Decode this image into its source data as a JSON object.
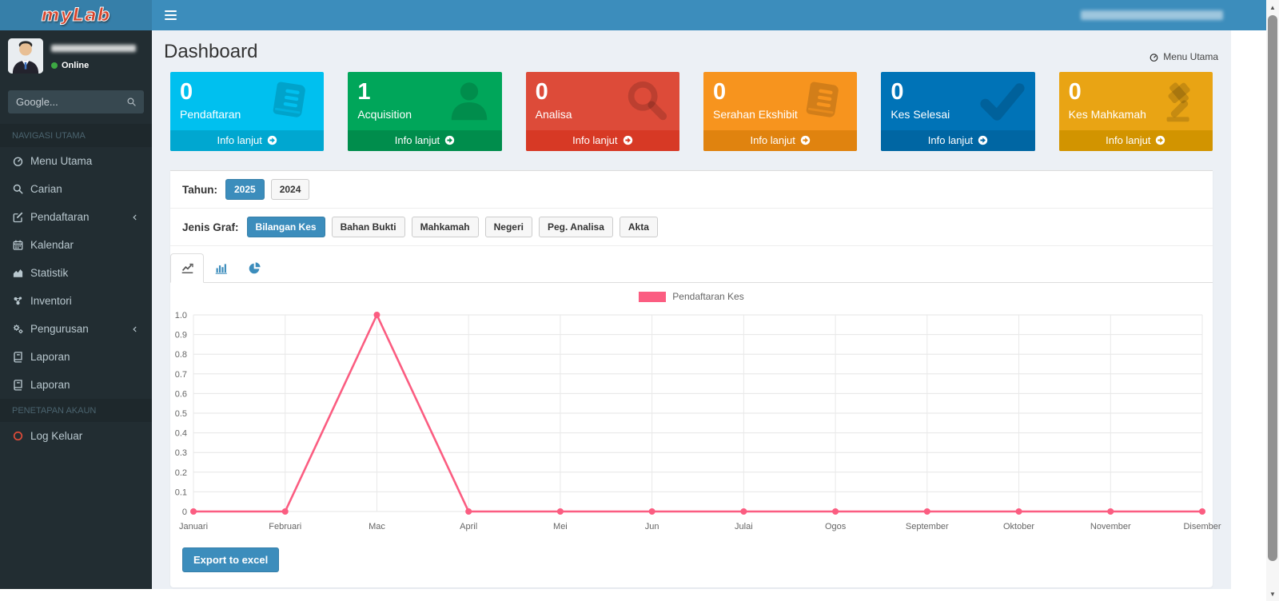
{
  "theme": {
    "accent": "#3c8dbc",
    "accent_dark": "#367fa9",
    "navbar_bg": "#3c8dbc",
    "logo_bg": "#367fa9",
    "sidebar_bg": "#222d32",
    "content_bg": "#ecf0f5"
  },
  "navbar": {
    "logo_text": "myLab"
  },
  "sidebar": {
    "user_status": "Online",
    "search_placeholder": "Google...",
    "section_nav": "NAVIGASI UTAMA",
    "section_account": "PENETAPAN AKAUN",
    "items": [
      {
        "label": "Menu Utama",
        "icon": "tachometer",
        "has_submenu": false
      },
      {
        "label": "Carian",
        "icon": "search",
        "has_submenu": false
      },
      {
        "label": "Pendaftaran",
        "icon": "edit",
        "has_submenu": true
      },
      {
        "label": "Kalendar",
        "icon": "calendar",
        "has_submenu": false
      },
      {
        "label": "Statistik",
        "icon": "area-chart",
        "has_submenu": false
      },
      {
        "label": "Inventori",
        "icon": "molecule",
        "has_submenu": false
      },
      {
        "label": "Pengurusan",
        "icon": "cogs",
        "has_submenu": true
      },
      {
        "label": "Laporan",
        "icon": "book",
        "has_submenu": false
      },
      {
        "label": "Laporan",
        "icon": "book",
        "has_submenu": false
      }
    ],
    "logout_label": "Log Keluar"
  },
  "header": {
    "title": "Dashboard",
    "breadcrumb": "Menu Utama"
  },
  "info_boxes": [
    {
      "value": "0",
      "label": "Pendaftaran",
      "footer": "Info lanjut",
      "color": "#00c0ef",
      "color_dark": "#00a7d0",
      "icon": "book"
    },
    {
      "value": "1",
      "label": "Acquisition",
      "footer": "Info lanjut",
      "color": "#00a65a",
      "color_dark": "#008d4c",
      "icon": "user"
    },
    {
      "value": "0",
      "label": "Analisa",
      "footer": "Info lanjut",
      "color": "#dd4b39",
      "color_dark": "#d73925",
      "icon": "search"
    },
    {
      "value": "0",
      "label": "Serahan Ekshibit",
      "footer": "Info lanjut",
      "color": "#f7941e",
      "color_dark": "#e0830f",
      "icon": "book"
    },
    {
      "value": "0",
      "label": "Kes Selesai",
      "footer": "Info lanjut",
      "color": "#0073b7",
      "color_dark": "#0066a3",
      "icon": "check"
    },
    {
      "value": "0",
      "label": "Kes Mahkamah",
      "footer": "Info lanjut",
      "color": "#e9a414",
      "color_dark": "#d29400",
      "icon": "gavel"
    }
  ],
  "filters": {
    "tahun_label": "Tahun:",
    "years": [
      {
        "label": "2025",
        "active": true
      },
      {
        "label": "2024",
        "active": false
      }
    ],
    "jenis_label": "Jenis Graf:",
    "types": [
      {
        "label": "Bilangan Kes",
        "active": true
      },
      {
        "label": "Bahan Bukti",
        "active": false
      },
      {
        "label": "Mahkamah",
        "active": false
      },
      {
        "label": "Negeri",
        "active": false
      },
      {
        "label": "Peg. Analisa",
        "active": false
      },
      {
        "label": "Akta",
        "active": false
      }
    ]
  },
  "tabs": [
    {
      "icon": "line-chart",
      "active": true
    },
    {
      "icon": "bar-chart",
      "active": false
    },
    {
      "icon": "pie-chart",
      "active": false
    }
  ],
  "chart_data": {
    "type": "line",
    "categories": [
      "Januari",
      "Februari",
      "Mac",
      "April",
      "Mei",
      "Jun",
      "Julai",
      "Ogos",
      "September",
      "Oktober",
      "November",
      "Disember"
    ],
    "series": [
      {
        "name": "Pendaftaran Kes",
        "color": "#fb5d81",
        "values": [
          0,
          0,
          1,
          0,
          0,
          0,
          0,
          0,
          0,
          0,
          0,
          0
        ]
      }
    ],
    "ylim": [
      0,
      1.0
    ],
    "ytick_step": 0.1,
    "grid": true,
    "legend_position": "top"
  },
  "export_label": "Export to excel"
}
